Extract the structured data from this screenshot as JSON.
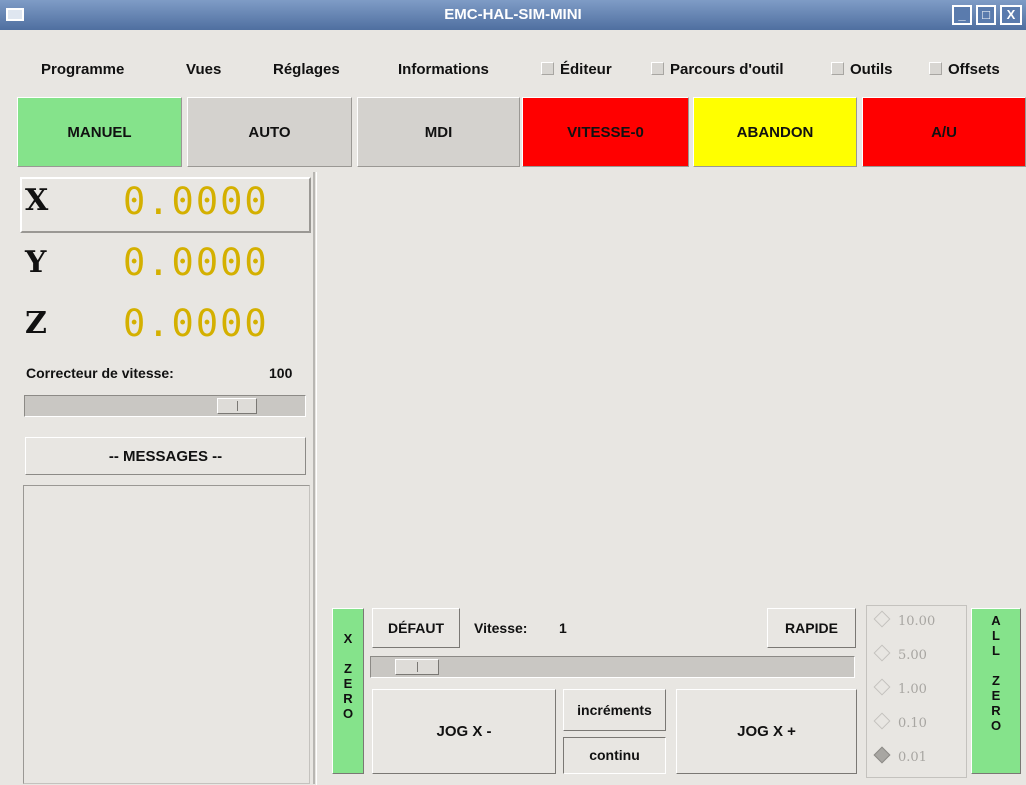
{
  "window": {
    "title": "EMC-HAL-SIM-MINI",
    "btn_min": "_",
    "btn_max": "□",
    "btn_close": "X"
  },
  "menu": {
    "items": [
      "Programme",
      "Vues",
      "Réglages",
      "Informations"
    ],
    "checks": [
      {
        "label": "Éditeur",
        "checked": false
      },
      {
        "label": "Parcours d'outil",
        "checked": false
      },
      {
        "label": "Outils",
        "checked": false
      },
      {
        "label": "Offsets",
        "checked": false
      }
    ]
  },
  "modes": [
    {
      "label": "MANUEL",
      "color": "#85e38b",
      "text_color": "#111111"
    },
    {
      "label": "AUTO",
      "color": "#d4d2ce",
      "text_color": "#111111"
    },
    {
      "label": "MDI",
      "color": "#d4d2ce",
      "text_color": "#111111"
    },
    {
      "label": "VITESSE-0",
      "color": "#ff0000",
      "text_color": "#111111"
    },
    {
      "label": "ABANDON",
      "color": "#ffff00",
      "text_color": "#111111"
    },
    {
      "label": "A/U",
      "color": "#ff0000",
      "text_color": "#111111"
    }
  ],
  "axes": [
    {
      "letter": "X",
      "value": "0.0000"
    },
    {
      "letter": "Y",
      "value": "0.0000"
    },
    {
      "letter": "Z",
      "value": "0.0000"
    }
  ],
  "feed_override": {
    "label": "Correcteur de vitesse:",
    "value": "100",
    "fraction": 0.8
  },
  "messages": {
    "button": "-- MESSAGES --"
  },
  "jog": {
    "x_zero": [
      "X",
      "",
      "Z",
      "E",
      "R",
      "O"
    ],
    "default_btn": "DÉFAUT",
    "speed_label": "Vitesse:",
    "speed_value": "1",
    "rapid_btn": "RAPIDE",
    "speed_fraction": 0.05,
    "jog_minus": "JOG X -",
    "jog_plus": "JOG X +",
    "increments_btn": "incréments",
    "continuous_btn": "continu",
    "increments": [
      {
        "label": "10.00",
        "selected": false
      },
      {
        "label": "5.00",
        "selected": false
      },
      {
        "label": "1.00",
        "selected": false
      },
      {
        "label": "0.10",
        "selected": false
      },
      {
        "label": "0.01",
        "selected": true
      }
    ],
    "all_zero": [
      "A",
      "L",
      "L",
      "",
      "Z",
      "E",
      "R",
      "O"
    ]
  },
  "colors": {
    "accent_green": "#85e38b",
    "dro_yellow": "#d4b000"
  }
}
